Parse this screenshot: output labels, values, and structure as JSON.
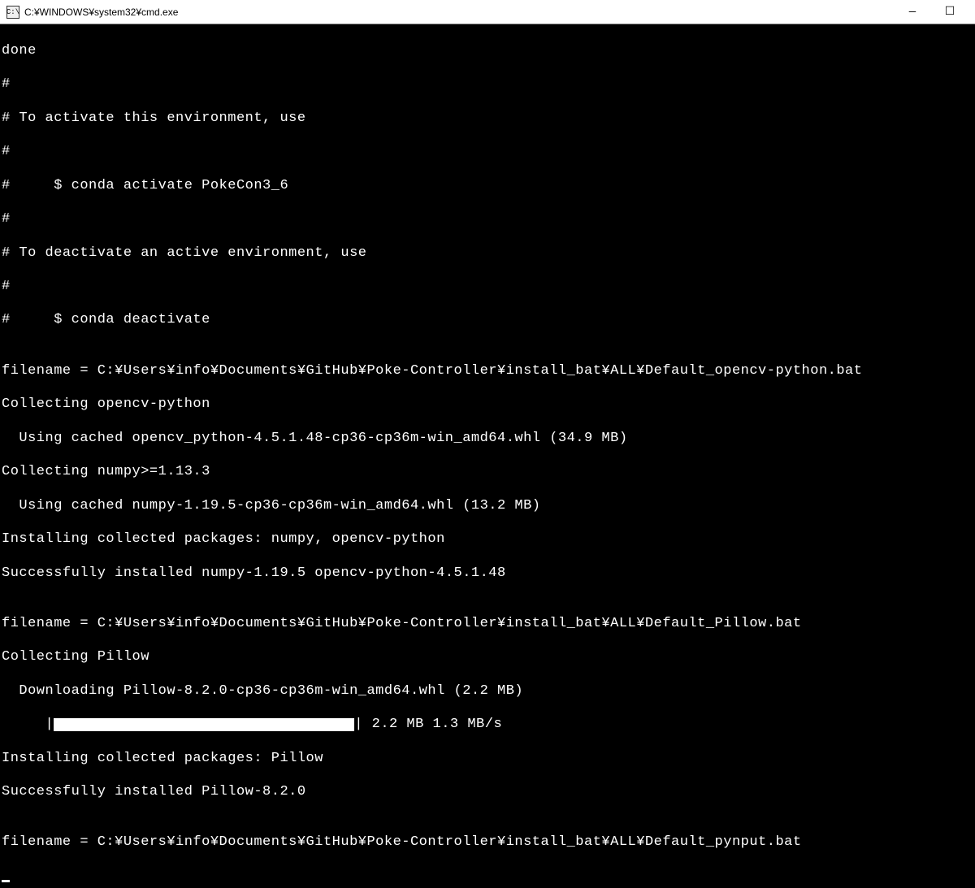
{
  "titlebar": {
    "icon_label": "C:\\",
    "title": "C:¥WINDOWS¥system32¥cmd.exe"
  },
  "lines": {
    "l0": "done",
    "l1": "#",
    "l2": "# To activate this environment, use",
    "l3": "#",
    "l4": "#     $ conda activate PokeCon3_6",
    "l5": "#",
    "l6": "# To deactivate an active environment, use",
    "l7": "#",
    "l8": "#     $ conda deactivate",
    "l9": "",
    "l10": "filename = C:¥Users¥info¥Documents¥GitHub¥Poke-Controller¥install_bat¥ALL¥Default_opencv-python.bat",
    "l11": "Collecting opencv-python",
    "l12": "  Using cached opencv_python-4.5.1.48-cp36-cp36m-win_amd64.whl (34.9 MB)",
    "l13": "Collecting numpy>=1.13.3",
    "l14": "  Using cached numpy-1.19.5-cp36-cp36m-win_amd64.whl (13.2 MB)",
    "l15": "Installing collected packages: numpy, opencv-python",
    "l16": "Successfully installed numpy-1.19.5 opencv-python-4.5.1.48",
    "l17": "",
    "l18": "filename = C:¥Users¥info¥Documents¥GitHub¥Poke-Controller¥install_bat¥ALL¥Default_Pillow.bat",
    "l19": "Collecting Pillow",
    "l20": "  Downloading Pillow-8.2.0-cp36-cp36m-win_amd64.whl (2.2 MB)",
    "l21_prefix": "     |",
    "l21_suffix": "| 2.2 MB 1.3 MB/s",
    "l22": "Installing collected packages: Pillow",
    "l23": "Successfully installed Pillow-8.2.0",
    "l24": "",
    "l25": "filename = C:¥Users¥info¥Documents¥GitHub¥Poke-Controller¥install_bat¥ALL¥Default_pynput.bat"
  }
}
